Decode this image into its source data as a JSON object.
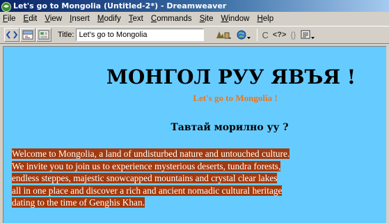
{
  "window": {
    "title": "Let's go to Mongolia (Untitled-2*) - Dreamweaver"
  },
  "menu": [
    {
      "label": "File",
      "acc": "F"
    },
    {
      "label": "Edit",
      "acc": "E"
    },
    {
      "label": "View",
      "acc": "V"
    },
    {
      "label": "Insert",
      "acc": "I"
    },
    {
      "label": "Modify",
      "acc": "M"
    },
    {
      "label": "Text",
      "acc": "T"
    },
    {
      "label": "Commands",
      "acc": "C"
    },
    {
      "label": "Site",
      "acc": "S"
    },
    {
      "label": "Window",
      "acc": "W"
    },
    {
      "label": "Help",
      "acc": "H"
    }
  ],
  "toolbar": {
    "title_label": "Title:",
    "title_value": "Let's go to Mongolia",
    "code_view_icon": "code-view-icon",
    "split_view_icon": "split-view-icon",
    "design_view_icon": "design-view-icon",
    "file_management_icon": "file-management-icon",
    "preview_icon": "globe-preview-icon",
    "refresh_icon": "refresh-icon",
    "reference_icon": "reference-icon",
    "code_nav_icon": "code-navigation-icon",
    "view_options_icon": "view-options-icon",
    "refresh_glyph": "C",
    "reference_glyph": "<?>",
    "code_nav_glyph": "{}"
  },
  "document": {
    "background": "#66ccff",
    "heading": "МОНГОЛ РУУ ЯВЪЯ !",
    "subheading": "Let's go to Mongolia !",
    "subtitle": "Тавтай морилно уу ?",
    "paragraph_lines": [
      "Welcome to Mongolia, a land of undisturbed nature and untouched culture.",
      "We invite you to join us to experience mysterious deserts, tundra forests,",
      "endless steppes, majestic snowcapped mountains and crystal clear lakes",
      "all in one place and discover a rich and ancient nomadic cultural heritage",
      "dating to the time of Genghis Khan."
    ],
    "subheading_color": "#e87522",
    "selection_color": "#a33a0d"
  }
}
